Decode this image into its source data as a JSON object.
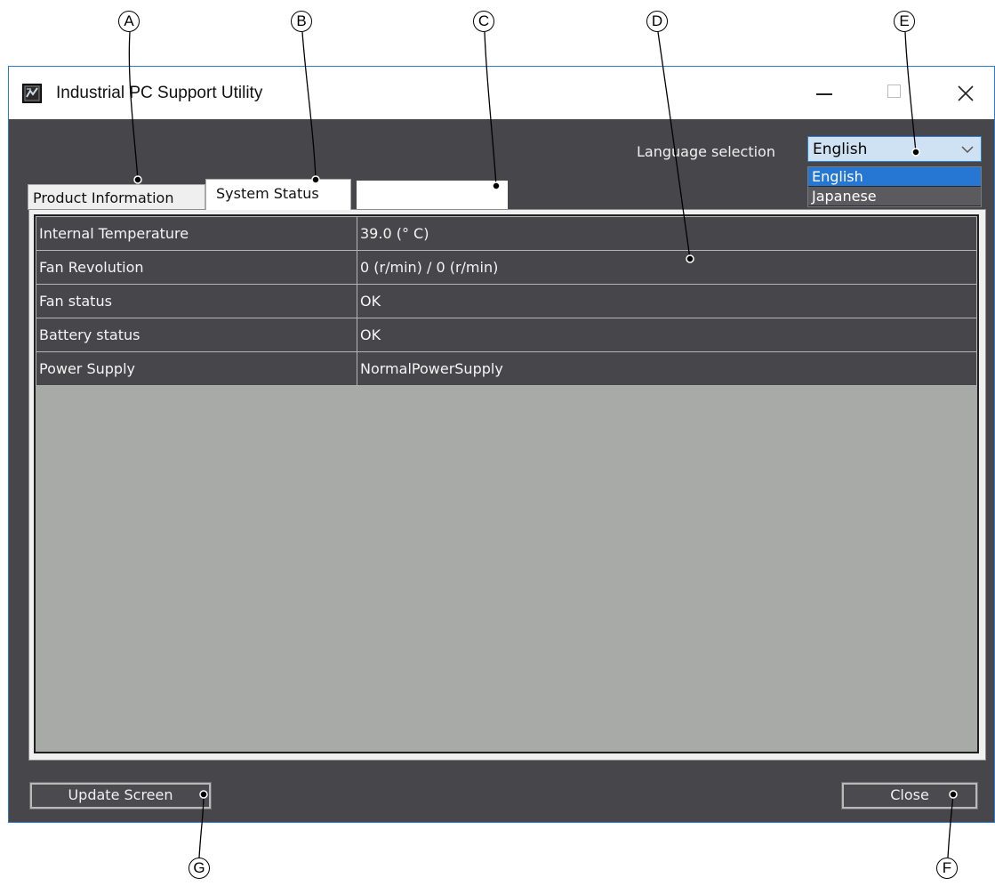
{
  "callouts": [
    "A",
    "B",
    "C",
    "D",
    "E",
    "F",
    "G"
  ],
  "window": {
    "title": "Industrial PC Support Utility",
    "icon": "app-icon",
    "controls": [
      "minimize-icon",
      "maximize-icon",
      "close-icon"
    ]
  },
  "language": {
    "label": "Language selection",
    "selected": "English",
    "options": [
      "English",
      "Japanese"
    ]
  },
  "tabs": [
    {
      "label": "Product Information",
      "active": false
    },
    {
      "label": "System Status",
      "active": true
    },
    {
      "label": "",
      "active": false
    }
  ],
  "status_table": {
    "rows": [
      [
        "Internal Temperature",
        "39.0 (° C)"
      ],
      [
        "Fan Revolution",
        "0 (r/min) / 0 (r/min)"
      ],
      [
        "Fan status",
        "OK"
      ],
      [
        "Battery status",
        "OK"
      ],
      [
        "Power Supply",
        "NormalPowerSupply"
      ]
    ]
  },
  "buttons": {
    "update": "Update Screen",
    "close": "Close"
  },
  "colors": {
    "window_background": "#46464a",
    "grid_row": "#47474b",
    "grid_empty": "#a8aaa8",
    "selection_accent": "#2677d4",
    "frame_border": "#2b7bd0"
  }
}
